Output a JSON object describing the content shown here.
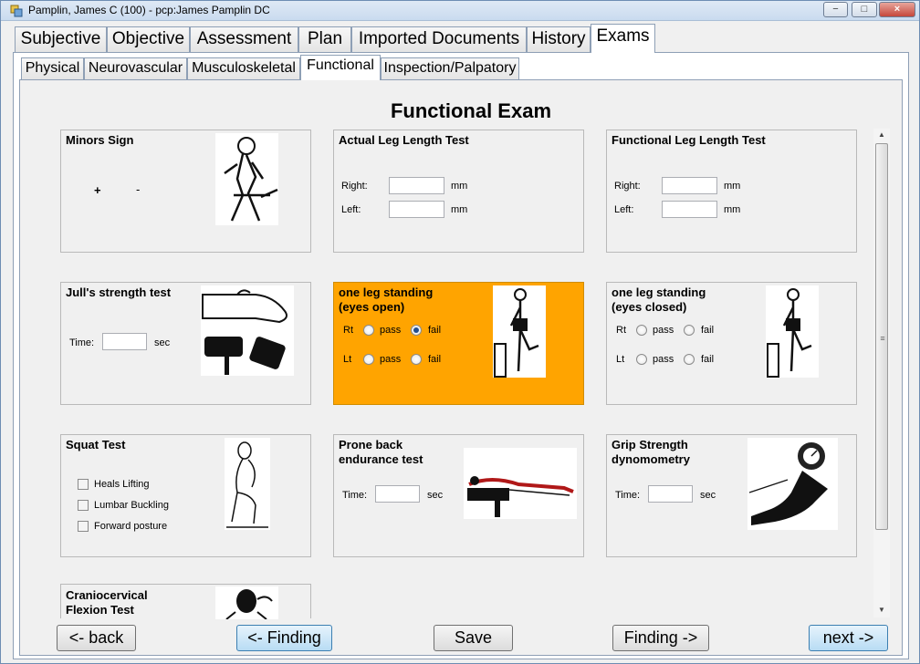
{
  "window": {
    "title": "Pamplin, James C (100) - pcp:James Pamplin DC",
    "minimize_glyph": "−",
    "maximize_glyph": "□",
    "close_glyph": "×"
  },
  "main_tabs": [
    "Subjective",
    "Objective",
    "Assessment",
    "Plan",
    "Imported Documents",
    "History",
    "Exams"
  ],
  "sub_tabs": [
    "Physical",
    "Neurovascular",
    "Musculoskeletal",
    "Functional",
    "Inspection/Palpatory"
  ],
  "page_title": "Functional Exam",
  "cards": {
    "minors": {
      "title": "Minors Sign",
      "plus": "+",
      "minus": "-",
      "image": "seated-figure-icon"
    },
    "actual_leg": {
      "title": "Actual Leg Length Test",
      "right_label": "Right:",
      "left_label": "Left:",
      "right_value": "",
      "left_value": "",
      "unit": "mm"
    },
    "functional_leg": {
      "title": "Functional Leg Length Test",
      "right_label": "Right:",
      "left_label": "Left:",
      "right_value": "",
      "left_value": "",
      "unit": "mm"
    },
    "jull": {
      "title": "Jull's strength test",
      "time_label": "Time:",
      "time_value": "",
      "unit": "sec",
      "image": "neck-flexion-icon"
    },
    "one_leg_open": {
      "title_line1": "one leg standing",
      "title_line2": "(eyes open)",
      "rt": "Rt",
      "lt": "Lt",
      "pass": "pass",
      "fail": "fail",
      "rt_selected": "fail",
      "lt_selected": "",
      "highlight_color": "#ffa400"
    },
    "one_leg_closed": {
      "title_line1": "one leg standing",
      "title_line2": "(eyes closed)",
      "rt": "Rt",
      "lt": "Lt",
      "pass": "pass",
      "fail": "fail",
      "rt_selected": "",
      "lt_selected": ""
    },
    "squat": {
      "title": "Squat Test",
      "options": [
        "Heals Lifting",
        "Lumbar Buckling",
        "Forward posture"
      ]
    },
    "prone": {
      "title_line1": "Prone back",
      "title_line2": "endurance test",
      "time_label": "Time:",
      "time_value": "",
      "unit": "sec"
    },
    "grip": {
      "title_line1": "Grip Strength",
      "title_line2": "dynomometry",
      "time_label": "Time:",
      "time_value": "",
      "unit": "sec"
    },
    "craniocervical": {
      "title_line1": "Craniocervical",
      "title_line2": "Flexion Test"
    }
  },
  "scrollbar": {
    "up": "▲",
    "down": "▼",
    "grip": "≡"
  },
  "buttons": {
    "back": "<- back",
    "finding_prev": "<- Finding",
    "save": "Save",
    "finding_next": "Finding ->",
    "next": "next ->"
  }
}
